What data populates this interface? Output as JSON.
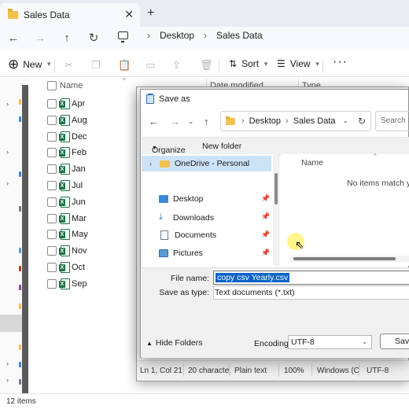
{
  "explorer": {
    "tab_title": "Sales Data",
    "breadcrumb": [
      "Desktop",
      "Sales Data"
    ],
    "toolbar": {
      "new_label": "New",
      "sort_label": "Sort",
      "view_label": "View"
    },
    "columns": {
      "name": "Name",
      "date_modified": "Date modified",
      "type": "Type"
    },
    "files": [
      "Apr",
      "Aug",
      "Dec",
      "Feb",
      "Jan",
      "Jul",
      "Jun",
      "Mar",
      "May",
      "Nov",
      "Oct",
      "Sep"
    ],
    "status": "12 items"
  },
  "notepad_status": {
    "position": "Ln 1, Col 21",
    "chars": "20 characte",
    "format": "Plain text",
    "zoom": "100%",
    "line_ending": "Windows (C",
    "encoding": "UTF-8"
  },
  "dialog": {
    "title": "Save as",
    "address": [
      "Desktop",
      "Sales Data"
    ],
    "search_placeholder": "Search Sa",
    "organize_label": "Organize",
    "new_folder_label": "New folder",
    "tree": {
      "onedrive": "OneDrive - Personal",
      "desktop": "Desktop",
      "downloads": "Downloads",
      "documents": "Documents",
      "pictures": "Pictures"
    },
    "list_header": "Name",
    "empty_message": "No items match you",
    "file_name_label": "File name:",
    "file_name_value": "copy csv Yearly.csv",
    "save_type_label": "Save as type:",
    "save_type_value": "Text documents (*.txt)",
    "hide_folders_label": "Hide Folders",
    "encoding_label": "Encoding:",
    "encoding_value": "UTF-8",
    "save_label": "Save"
  },
  "colors": {
    "selection": "#0a64c8",
    "tree_selected": "#cce3f7",
    "excel_green": "#1f7246",
    "folder_yellow": "#f2c14e"
  }
}
